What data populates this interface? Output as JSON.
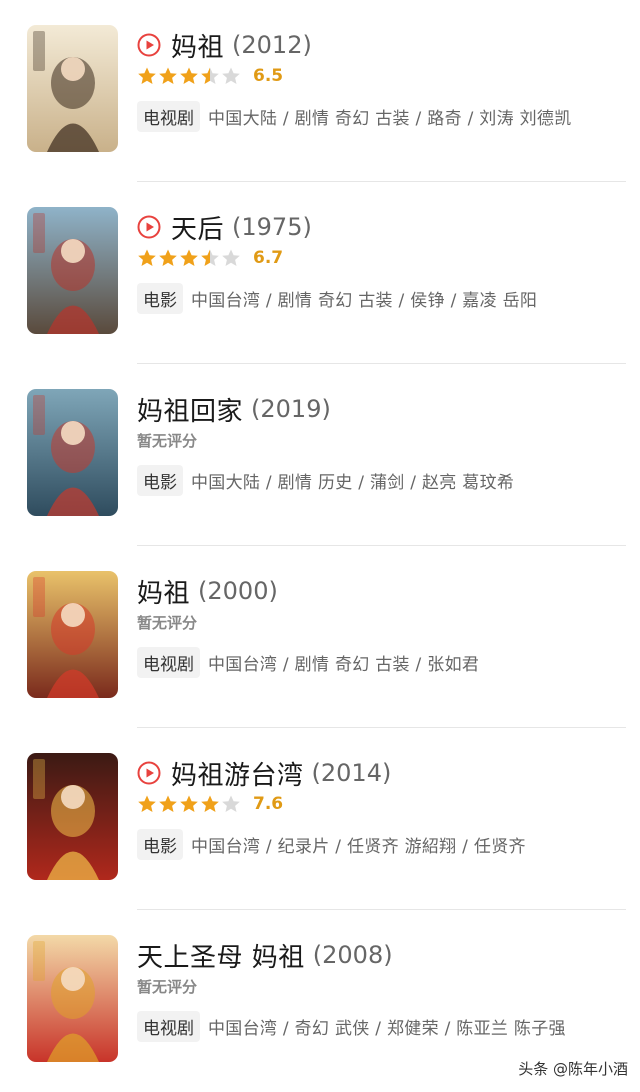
{
  "colors": {
    "accent_red": "#e8423e",
    "star_gold": "#f0a11a",
    "star_gray": "#d9d9d9",
    "score_gold": "#e09a15"
  },
  "items": [
    {
      "title": "妈祖",
      "year": "(2012)",
      "playable": true,
      "rating": 3.5,
      "score": "6.5",
      "no_rating_text": "",
      "type": "电视剧",
      "meta": "中国大陆 / 剧情 奇幻 古装 / 路奇 / 刘涛 刘德凯",
      "poster": {
        "icon": "poster-tv-2012",
        "bg1": "#f3ead6",
        "bg2": "#c9b18a",
        "accent": "#3a2a1c"
      }
    },
    {
      "title": "天后",
      "year": "(1975)",
      "playable": true,
      "rating": 3.5,
      "score": "6.7",
      "no_rating_text": "",
      "type": "电影",
      "meta": "中国台湾 / 剧情 奇幻 古装 / 侯铮 / 嘉凌 岳阳",
      "poster": {
        "icon": "poster-film-1975",
        "bg1": "#8fb3c9",
        "bg2": "#5a4a3c",
        "accent": "#b8352c"
      }
    },
    {
      "title": "妈祖回家",
      "year": "(2019)",
      "playable": false,
      "rating": 0,
      "score": "",
      "no_rating_text": "暂无评分",
      "type": "电影",
      "meta": "中国大陆 / 剧情 历史 / 蒲剑 / 赵亮 葛玟希",
      "poster": {
        "icon": "poster-film-2019",
        "bg1": "#7fa6b8",
        "bg2": "#2f4c5e",
        "accent": "#c53a2e"
      }
    },
    {
      "title": "妈祖",
      "year": "(2000)",
      "playable": false,
      "rating": 0,
      "score": "",
      "no_rating_text": "暂无评分",
      "type": "电视剧",
      "meta": "中国台湾 / 剧情 奇幻 古装 / 张如君",
      "poster": {
        "icon": "poster-tv-2000",
        "bg1": "#e9c26a",
        "bg2": "#7a2a1c",
        "accent": "#d63a2a"
      }
    },
    {
      "title": "妈祖游台湾",
      "year": "(2014)",
      "playable": true,
      "rating": 4,
      "score": "7.6",
      "no_rating_text": "",
      "type": "电影",
      "meta": "中国台湾 / 纪录片 / 任贤齐 游紹翔 / 任贤齐",
      "poster": {
        "icon": "poster-film-2014",
        "bg1": "#3b1a14",
        "bg2": "#b0281c",
        "accent": "#f2c14a"
      }
    },
    {
      "title": "天上圣母 妈祖",
      "year": "(2008)",
      "playable": false,
      "rating": 0,
      "score": "",
      "no_rating_text": "暂无评分",
      "type": "电视剧",
      "meta": "中国台湾 / 奇幻 武侠 / 郑健荣 / 陈亚兰 陈子强",
      "poster": {
        "icon": "poster-tv-2008",
        "bg1": "#f3d9a8",
        "bg2": "#c8342a",
        "accent": "#e0a22a"
      }
    }
  ],
  "watermark": "头条 @陈年小酒"
}
